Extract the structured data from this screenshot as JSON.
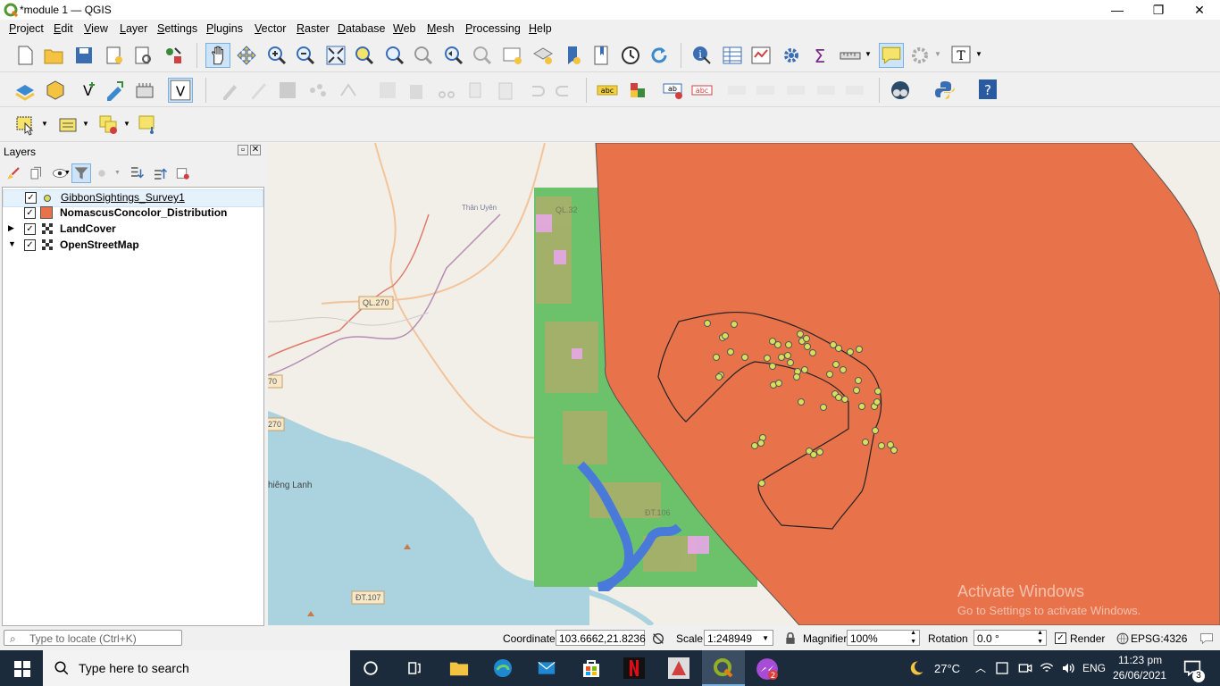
{
  "window": {
    "title": "*module 1 — QGIS"
  },
  "menu": [
    "Project",
    "Edit",
    "View",
    "Layer",
    "Settings",
    "Plugins",
    "Vector",
    "Raster",
    "Database",
    "Web",
    "Mesh",
    "Processing",
    "Help"
  ],
  "layers_panel": {
    "title": "Layers",
    "layers": [
      {
        "name": "GibbonSightings_Survey1",
        "checked": true,
        "symbol": "point"
      },
      {
        "name": "NomascusConcolor_Distribution",
        "checked": true,
        "symbol": "polygon"
      },
      {
        "name": "LandCover",
        "checked": true,
        "symbol": "raster"
      },
      {
        "name": "OpenStreetMap",
        "checked": true,
        "symbol": "raster"
      }
    ]
  },
  "map": {
    "labels": {
      "road_ql270_a": "QL.270",
      "road_70": "70",
      "road_270": "270",
      "village": "Thân Uyên",
      "road_ql32": "QL.32",
      "road_dt106": "ĐT.106",
      "place": "hiêng Lanh",
      "road_dt107": "ĐT.107"
    },
    "colors": {
      "distribution": "#e8734a",
      "sightings": "#d6e05a",
      "landcover": "#6cc26a",
      "water": "#aad3df"
    },
    "watermark": {
      "line1": "Activate Windows",
      "line2": "Go to Settings to activate Windows."
    }
  },
  "status": {
    "locate_placeholder": "Type to locate (Ctrl+K)",
    "coordinate_label": "Coordinate",
    "coordinate_value": "103.6662,21.8236",
    "scale_label": "Scale",
    "scale_value": "1:248949",
    "magnifier_label": "Magnifier",
    "magnifier_value": "100%",
    "rotation_label": "Rotation",
    "rotation_value": "0.0 °",
    "render_label": "Render",
    "crs": "EPSG:4326"
  },
  "taskbar": {
    "search_placeholder": "Type here to search",
    "weather": "27°C",
    "language": "ENG",
    "time": "11:23 pm",
    "date": "26/06/2021",
    "notifications": "3"
  }
}
